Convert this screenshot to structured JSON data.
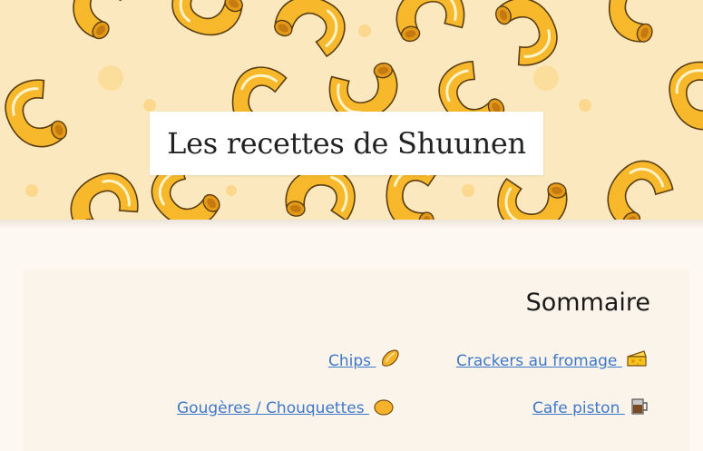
{
  "site": {
    "title": "Les recettes de Shuunen"
  },
  "toc": {
    "heading": "Sommaire",
    "items": [
      {
        "label": "Chips",
        "icon": "chips-icon"
      },
      {
        "label": "Crackers au fromage",
        "icon": "cheese-icon"
      },
      {
        "label": "Gougères / Chouquettes",
        "icon": "gougere-icon"
      },
      {
        "label": "Cafe piston",
        "icon": "coffee-press-icon"
      }
    ]
  },
  "colors": {
    "banner_bg": "#fce8be",
    "pasta": "#f7b92b",
    "pasta_dark": "#e49a18",
    "link": "#3f78c9"
  }
}
